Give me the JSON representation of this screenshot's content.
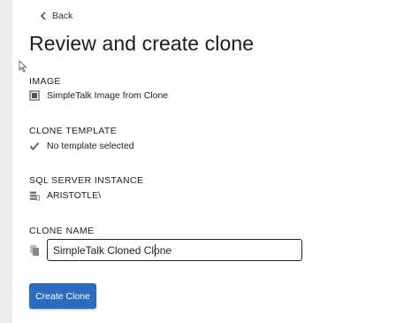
{
  "nav": {
    "back_label": "Back"
  },
  "page": {
    "title": "Review and create clone"
  },
  "image": {
    "label": "IMAGE",
    "value": "SimpleTalk Image from Clone",
    "icon": "image-icon"
  },
  "clone_template": {
    "label": "CLONE TEMPLATE",
    "value": "No template selected",
    "icon": "checkmark-icon"
  },
  "sql_instance": {
    "label": "SQL SERVER INSTANCE",
    "value": "ARISTOTLE\\",
    "icon": "server-icon"
  },
  "clone_name": {
    "label": "CLONE NAME",
    "value": "SimpleTalk Cloned Clone",
    "icon": "copy-icon"
  },
  "actions": {
    "create_label": "Create Clone"
  },
  "colors": {
    "primary_button": "#2e6bbf",
    "rail": "#ececec"
  }
}
